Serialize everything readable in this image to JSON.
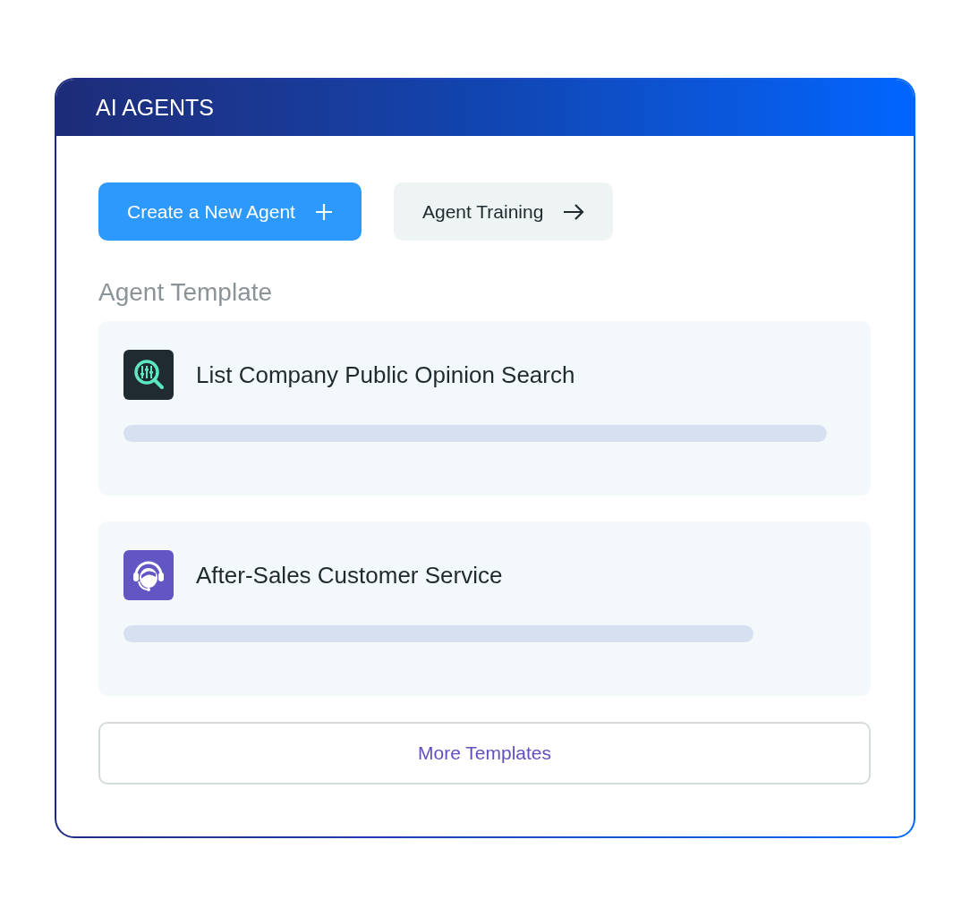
{
  "panel": {
    "title": "AI AGENTS"
  },
  "actions": [
    {
      "kind": "primary",
      "label": "Create a New Agent"
    },
    {
      "kind": "secondary",
      "label": "Agent Training"
    }
  ],
  "section": {
    "title": "Agent Template"
  },
  "templates": [
    {
      "kind": "search",
      "name": "List Company Public Opinion Search"
    },
    {
      "kind": "support",
      "name": "After-Sales Customer Service"
    }
  ],
  "more_button": {
    "label": "More Templates"
  }
}
